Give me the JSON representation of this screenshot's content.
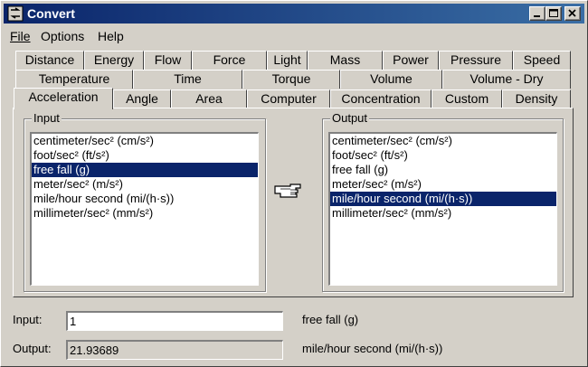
{
  "window": {
    "title": "Convert"
  },
  "menu": {
    "file": "File",
    "options": "Options",
    "help": "Help"
  },
  "tabs": {
    "row1": [
      "Distance",
      "Energy",
      "Flow",
      "Force",
      "Light",
      "Mass",
      "Power",
      "Pressure",
      "Speed"
    ],
    "row2": [
      "Temperature",
      "Time",
      "Torque",
      "Volume",
      "Volume - Dry"
    ],
    "row3": [
      "Acceleration",
      "Angle",
      "Area",
      "Computer",
      "Concentration",
      "Custom",
      "Density"
    ],
    "selected": "Acceleration"
  },
  "input_group": {
    "label": "Input",
    "items": [
      "centimeter/sec² (cm/s²)",
      "foot/sec² (ft/s²)",
      "free fall (g)",
      "meter/sec² (m/s²)",
      "mile/hour second (mi/(h·s))",
      "millimeter/sec² (mm/s²)"
    ],
    "selected_index": 2
  },
  "output_group": {
    "label": "Output",
    "items": [
      "centimeter/sec² (cm/s²)",
      "foot/sec² (ft/s²)",
      "free fall (g)",
      "meter/sec² (m/s²)",
      "mile/hour second (mi/(h·s))",
      "millimeter/sec² (mm/s²)"
    ],
    "selected_index": 4
  },
  "bottom": {
    "input_label": "Input:",
    "input_value": "1",
    "input_unit": "free fall (g)",
    "output_label": "Output:",
    "output_value": "21.93689",
    "output_unit": "mile/hour second (mi/(h·s))"
  },
  "icons": {
    "app": "convert-app-icon",
    "pointer": "pointing-hand-icon"
  }
}
